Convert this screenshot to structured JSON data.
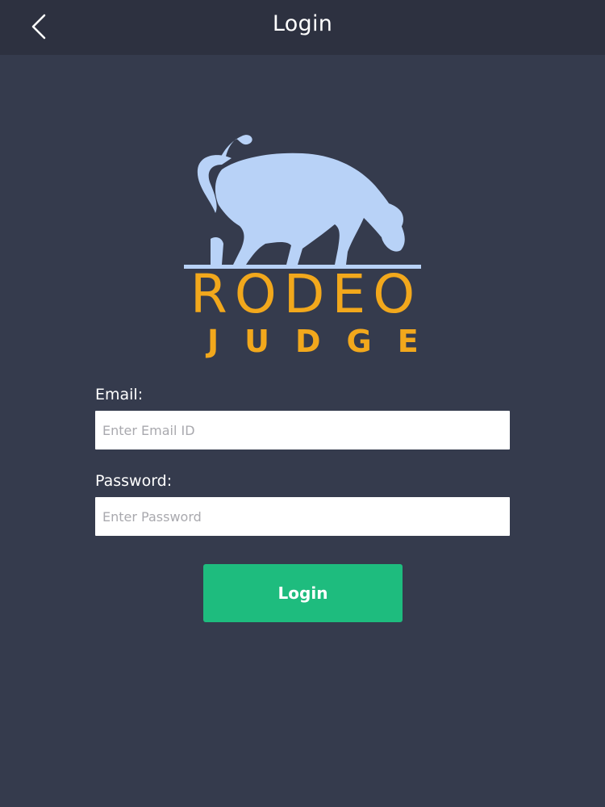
{
  "header": {
    "title": "Login",
    "back_icon": "chevron-left-icon"
  },
  "logo": {
    "icon": "bull-icon",
    "word_1": "RODEO",
    "word_2": "JUDGE",
    "colors": {
      "bull": "#b8d2f7",
      "text": "#f2a81c"
    }
  },
  "form": {
    "email_label": "Email:",
    "email_placeholder": "Enter Email ID",
    "email_value": "",
    "password_label": "Password:",
    "password_placeholder": "Enter Password",
    "password_value": "",
    "submit_label": "Login"
  },
  "colors": {
    "background": "#353b4d",
    "header_background": "#2d3140",
    "button": "#1ebc7e"
  }
}
